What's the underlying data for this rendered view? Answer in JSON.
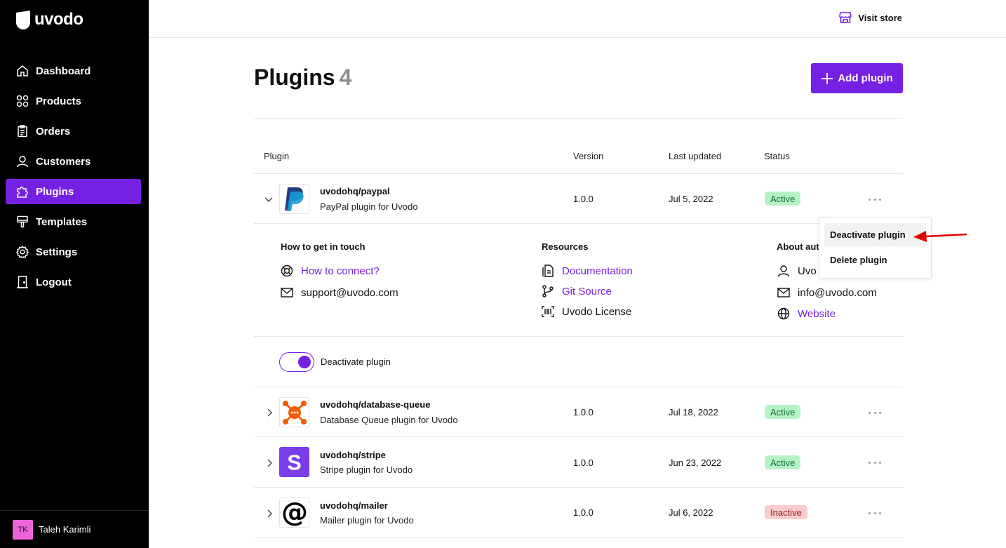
{
  "app": {
    "name": "uvodo"
  },
  "sidebar": {
    "items": [
      {
        "label": "Dashboard",
        "icon": "home-icon"
      },
      {
        "label": "Products",
        "icon": "grid-icon"
      },
      {
        "label": "Orders",
        "icon": "clipboard-icon"
      },
      {
        "label": "Customers",
        "icon": "user-icon"
      },
      {
        "label": "Plugins",
        "icon": "puzzle-icon",
        "active": true
      },
      {
        "label": "Templates",
        "icon": "brush-icon"
      },
      {
        "label": "Settings",
        "icon": "gear-icon"
      },
      {
        "label": "Logout",
        "icon": "door-icon"
      }
    ],
    "user": {
      "initials": "TK",
      "name": "Taleh Karimli"
    }
  },
  "topbar": {
    "visit_store": "Visit store"
  },
  "header": {
    "title": "Plugins",
    "count": "4",
    "add_button": "Add plugin"
  },
  "table": {
    "columns": [
      "Plugin",
      "Version",
      "Last updated",
      "Status"
    ],
    "rows": [
      {
        "name": "uvodohq/paypal",
        "description": "PayPal plugin for Uvodo",
        "version": "1.0.0",
        "updated": "Jul 5, 2022",
        "status": "Active",
        "logo": "paypal-logo",
        "expanded": true
      },
      {
        "name": "uvodohq/database-queue",
        "description": "Database Queue plugin for Uvodo",
        "version": "1.0.0",
        "updated": "Jul 18, 2022",
        "status": "Active",
        "logo": "database-queue-logo"
      },
      {
        "name": "uvodohq/stripe",
        "description": "Stripe plugin for Uvodo",
        "version": "1.0.0",
        "updated": "Jun 23, 2022",
        "status": "Active",
        "logo": "stripe-logo"
      },
      {
        "name": "uvodohq/mailer",
        "description": "Mailer plugin for Uvodo",
        "version": "1.0.0",
        "updated": "Jul 6, 2022",
        "status": "Inactive",
        "logo": "mailer-logo"
      }
    ]
  },
  "details": {
    "contact": {
      "title": "How to get in touch",
      "link": "How to connect?",
      "email": "support@uvodo.com"
    },
    "resources": {
      "title": "Resources",
      "docs": "Documentation",
      "git": "Git Source",
      "license": "Uvodo License"
    },
    "author": {
      "title": "About aut",
      "name": "Uvo",
      "email": "info@uvodo.com",
      "website": "Website"
    },
    "toggle_label": "Deactivate plugin"
  },
  "menu": {
    "items": [
      "Deactivate plugin",
      "Delete plugin"
    ]
  },
  "colors": {
    "accent": "#7521e3",
    "active_badge": "#b6f2c8",
    "inactive_badge": "#fbcaca",
    "arrow": "#e50000"
  }
}
